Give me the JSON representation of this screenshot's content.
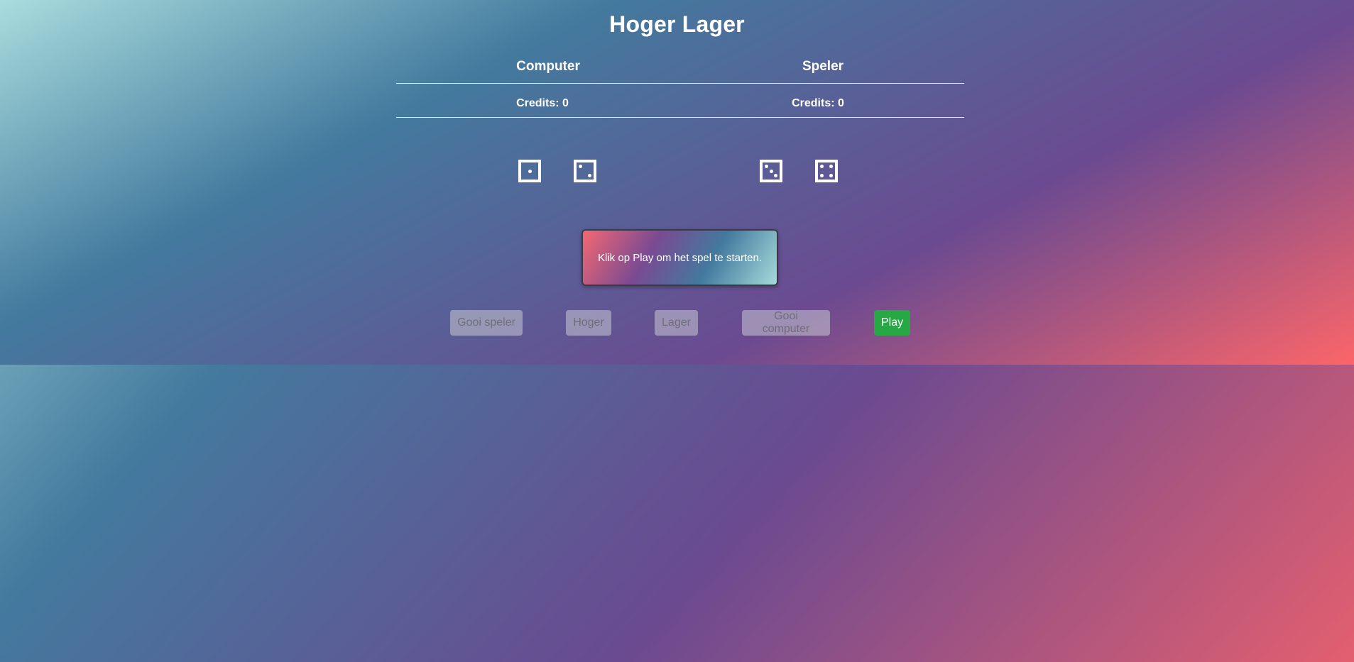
{
  "title": "Hoger Lager",
  "computer": {
    "label": "Computer",
    "credits": "Credits: 0",
    "dice": [
      1,
      2
    ]
  },
  "player": {
    "label": "Speler",
    "credits": "Credits: 0",
    "dice": [
      3,
      4
    ]
  },
  "message": "Klik op Play om het spel te starten.",
  "buttons": {
    "gooi_speler": "Gooi speler",
    "hoger": "Hoger",
    "lager": "Lager",
    "gooi_computer": "Gooi computer",
    "play": "Play"
  },
  "colors": {
    "play_button": "#28a745",
    "disabled_button": "#c8c8d2"
  }
}
